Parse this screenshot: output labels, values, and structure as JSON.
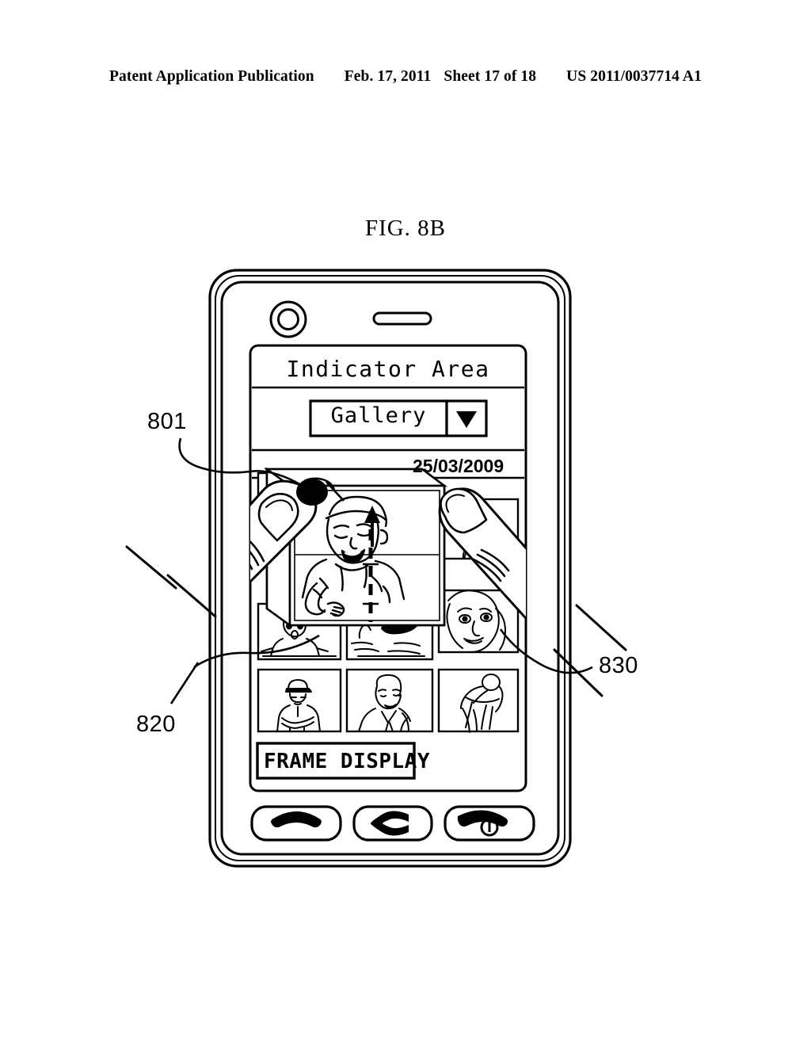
{
  "header": {
    "publication": "Patent Application Publication",
    "date": "Feb. 17, 2011",
    "sheet": "Sheet 17 of 18",
    "patent_number": "US 2011/0037714 A1"
  },
  "figure": {
    "label": "FIG. 8B"
  },
  "reference_numerals": [
    {
      "id": "801",
      "label": "801",
      "points_to": "touch-contact-point"
    },
    {
      "id": "820",
      "label": "820",
      "points_to": "left-finger"
    },
    {
      "id": "830",
      "label": "830",
      "points_to": "right-finger"
    }
  ],
  "device": {
    "hardware": {
      "camera_icon": "camera-lens-icon",
      "speaker_icon": "earpiece-speaker-icon",
      "buttons": [
        {
          "name": "send-key",
          "icon": "handset-icon",
          "label": ""
        },
        {
          "name": "clear-key",
          "icon": "c-clear-icon",
          "label": ""
        },
        {
          "name": "end-key",
          "icon": "handset-power-icon",
          "label": ""
        }
      ]
    },
    "screen": {
      "indicator_area": "Indicator Area",
      "dropdown": {
        "value": "Gallery",
        "arrow_icon": "chevron-down-icon"
      },
      "date": "25/03/2009",
      "gallery": {
        "enlarged_photo": {
          "caption": "baby-laughing",
          "state": "enlarged"
        },
        "thumbnails": [
          {
            "caption": "baby-laughing-large",
            "row": 1,
            "col": 2
          },
          {
            "caption": "woman-sunglasses",
            "row": 1,
            "col": 3
          },
          {
            "caption": "baby-surprised",
            "row": 2,
            "col": 1
          },
          {
            "caption": "boat-on-shore",
            "row": 2,
            "col": 2
          },
          {
            "caption": "womans-face-closeup",
            "row": 2,
            "col": 3
          },
          {
            "caption": "man-in-cap-arms-folded",
            "row": 3,
            "col": 1
          },
          {
            "caption": "man-in-suit-smiling",
            "row": 3,
            "col": 2
          },
          {
            "caption": "golfer-swinging",
            "row": 3,
            "col": 3
          }
        ]
      },
      "frame_display_button": "FRAME DISPLAY"
    }
  },
  "gesture": {
    "type": "pinch",
    "direction_arrow_icon": "arrow-up-icon",
    "contact_point_icon": "touch-dot-icon"
  },
  "colors": {
    "ink": "#000000",
    "paper": "#ffffff"
  }
}
